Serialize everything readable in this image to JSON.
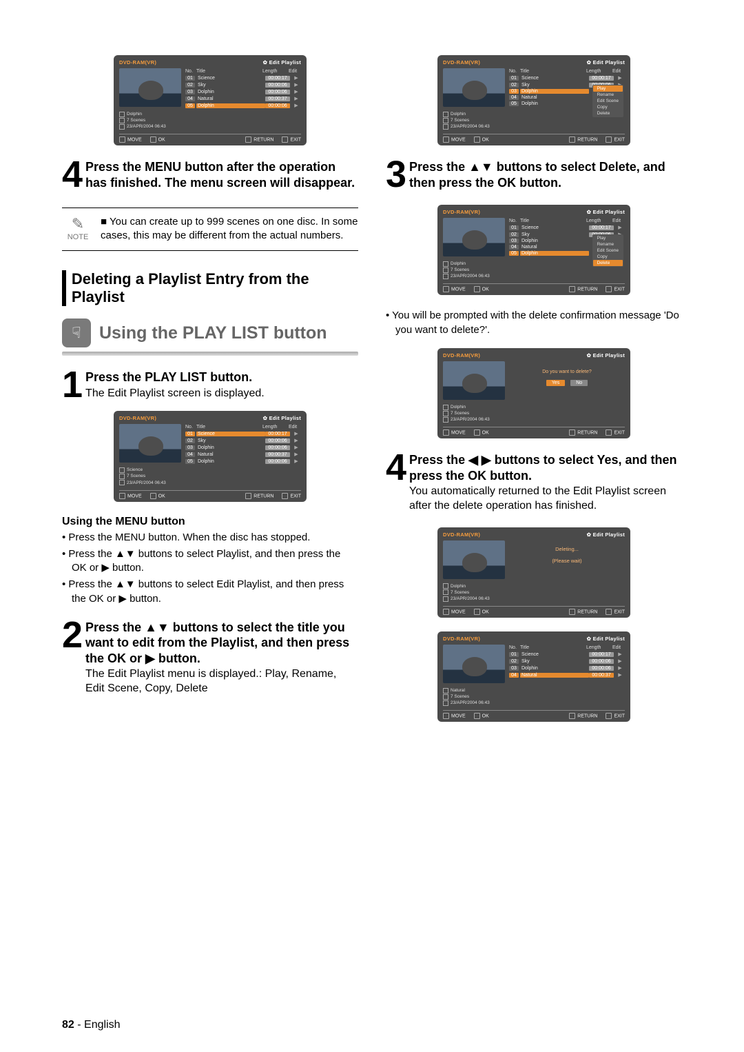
{
  "page": {
    "number": "82",
    "lang": "English"
  },
  "ss_common": {
    "mode": "DVD-RAM(VR)",
    "label": "Edit Playlist",
    "footer": {
      "move": "MOVE",
      "ok": "OK",
      "return": "RETURN",
      "exit": "EXIT"
    },
    "headers": {
      "no": "No.",
      "title": "Title",
      "length": "Length",
      "edit": "Edit"
    },
    "meta_scenes": "7 Scenes",
    "meta_date": "23/APR/2004 06:43"
  },
  "rows5": [
    {
      "n": "01",
      "t": "Science",
      "l": "00:00:17"
    },
    {
      "n": "02",
      "t": "Sky",
      "l": "00:00:06"
    },
    {
      "n": "03",
      "t": "Dolphin",
      "l": "00:00:06"
    },
    {
      "n": "04",
      "t": "Natural",
      "l": "00:00:37"
    },
    {
      "n": "05",
      "t": "Dolphin",
      "l": "00:00:06"
    }
  ],
  "rows4": [
    {
      "n": "01",
      "t": "Science",
      "l": "00:00:17"
    },
    {
      "n": "02",
      "t": "Sky",
      "l": "00:00:06"
    },
    {
      "n": "03",
      "t": "Dolphin",
      "l": "00:00:06"
    },
    {
      "n": "04",
      "t": "Natural",
      "l": "00:00:37"
    }
  ],
  "ctx_menu": {
    "items": [
      "Play",
      "Rename",
      "Edit Scene",
      "Copy",
      "Delete"
    ]
  },
  "meta_titles": {
    "dolphin": "Dolphin",
    "science": "Science",
    "natural": "Natural"
  },
  "left": {
    "step4": "Press the MENU button after the operation has finished. The menu screen will disappear.",
    "note": "You can create up to 999 scenes on one disc. In some cases, this may be different from the actual numbers.",
    "note_label": "NOTE",
    "section": "Deleting a Playlist Entry from the Playlist",
    "banner": "Using the PLAY LIST button",
    "step1": {
      "head": "Press the PLAY LIST button.",
      "sub": "The Edit Playlist screen is displayed."
    },
    "menu_head": "Using the MENU button",
    "menu_items": [
      "Press the MENU button. When the disc has stopped.",
      "Press the ▲▼ buttons to select Playlist, and then press the OK or ▶ button.",
      "Press the ▲▼ buttons to select Edit Playlist, and then press the OK or ▶ button."
    ],
    "step2": {
      "head": "Press the ▲▼ buttons to select the title you want to edit from the Playlist, and then press the OK or ▶ button.",
      "sub": "The Edit Playlist menu is displayed.: Play, Rename, Edit Scene, Copy, Delete"
    }
  },
  "right": {
    "step3": "Press the ▲▼ buttons to select Delete, and then press the OK button.",
    "prompt": "You will be prompted with the delete confirmation message 'Do you want to delete?'.",
    "confirm_q": "Do you want to delete?",
    "yes": "Yes",
    "no": "No",
    "step4": {
      "head": "Press the ◀ ▶ buttons to select Yes, and then press the OK button.",
      "sub": "You automatically returned to the Edit Playlist screen after the delete operation has finished."
    },
    "deleting": "Deleting...",
    "wait": "(Please wait)"
  }
}
